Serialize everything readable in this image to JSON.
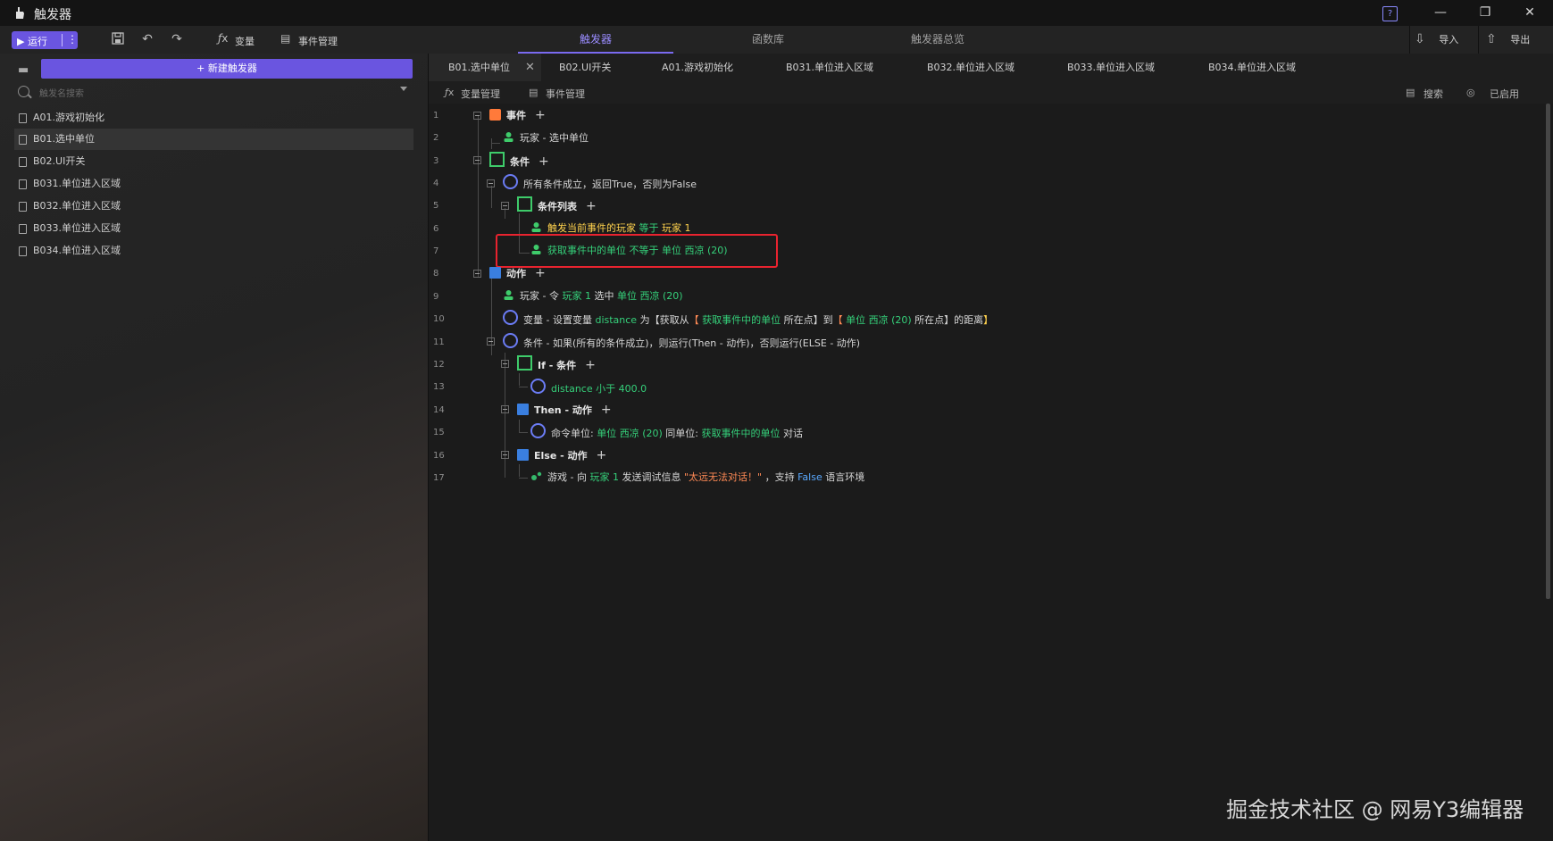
{
  "window": {
    "title": "触发器",
    "help": "?"
  },
  "toolbar": {
    "run_label": "▶ 运行",
    "more": "⋮",
    "var_label": "变量",
    "event_mgr_label": "事件管理",
    "center_tabs": [
      "触发器",
      "函数库",
      "触发器总览"
    ],
    "import_label": "导入",
    "export_label": "导出"
  },
  "sidebar": {
    "new_button": "+ 新建触发器",
    "search_placeholder": "触发名搜索",
    "items": [
      "A01.游戏初始化",
      "B01.选中单位",
      "B02.UI开关",
      "B031.单位进入区域",
      "B032.单位进入区域",
      "B033.单位进入区域",
      "B034.单位进入区域"
    ],
    "selected_index": 1
  },
  "file_tabs": [
    "B01.选中单位",
    "B02.UI开关",
    "A01.游戏初始化",
    "B031.单位进入区域",
    "B032.单位进入区域",
    "B033.单位进入区域",
    "B034.单位进入区域"
  ],
  "subbar": {
    "var_mgr": "变量管理",
    "event_mgr": "事件管理",
    "search": "搜索",
    "enabled": "已启用"
  },
  "lines": {
    "l1": "事件",
    "l2": "玩家 - 选中单位",
    "l3": "条件",
    "l4": "所有条件成立，返回True，否则为False",
    "l5": "条件列表",
    "l6a": "触发当前事件的玩家",
    "l6b": "等于",
    "l6c": "玩家 1",
    "l7a": "获取事件中的单位",
    "l7b": "不等于",
    "l7c": "单位 西凉 (20)",
    "l8": "动作",
    "l9a": "玩家 - 令",
    "l9b": "玩家 1",
    "l9c": "选中",
    "l9d": "单位 西凉 (20)",
    "l10a": "变量 - 设置变量",
    "l10b": "distance",
    "l10c": "为【获取从",
    "l10d": "【",
    "l10e": "获取事件中的单位",
    "l10f": "所在点】到",
    "l10g": "【",
    "l10h": "单位 西凉 (20)",
    "l10i": "所在点】的距离",
    "l10j": "】",
    "l11": "条件 - 如果(所有的条件成立)，则运行(Then - 动作)，否则运行(ELSE - 动作)",
    "l12": "If - 条件",
    "l13a": "distance",
    "l13b": "小于",
    "l13c": "400.0",
    "l14": "Then - 动作",
    "l15a": "命令单位:",
    "l15b": "单位 西凉 (20)",
    "l15c": "同单位:",
    "l15d": "获取事件中的单位",
    "l15e": "对话",
    "l16": "Else - 动作",
    "l17a": "游戏 - 向",
    "l17b": "玩家 1",
    "l17c": "发送调试信息",
    "l17d": "\"太远无法对话！\"",
    "l17e": "，支持",
    "l17f": "False",
    "l17g": "语言环境"
  },
  "line_numbers": [
    "1",
    "2",
    "3",
    "4",
    "5",
    "6",
    "7",
    "8",
    "9",
    "10",
    "11",
    "12",
    "13",
    "14",
    "15",
    "16",
    "17"
  ],
  "watermark": "掘金技术社区 @ 网易Y3编辑器",
  "colors": {
    "accent": "#6a55e0",
    "green": "#35d07a",
    "yellow": "#ffd24d",
    "orange": "#ff8a55",
    "blue": "#5aa9ff",
    "highlight": "#e8232f"
  }
}
